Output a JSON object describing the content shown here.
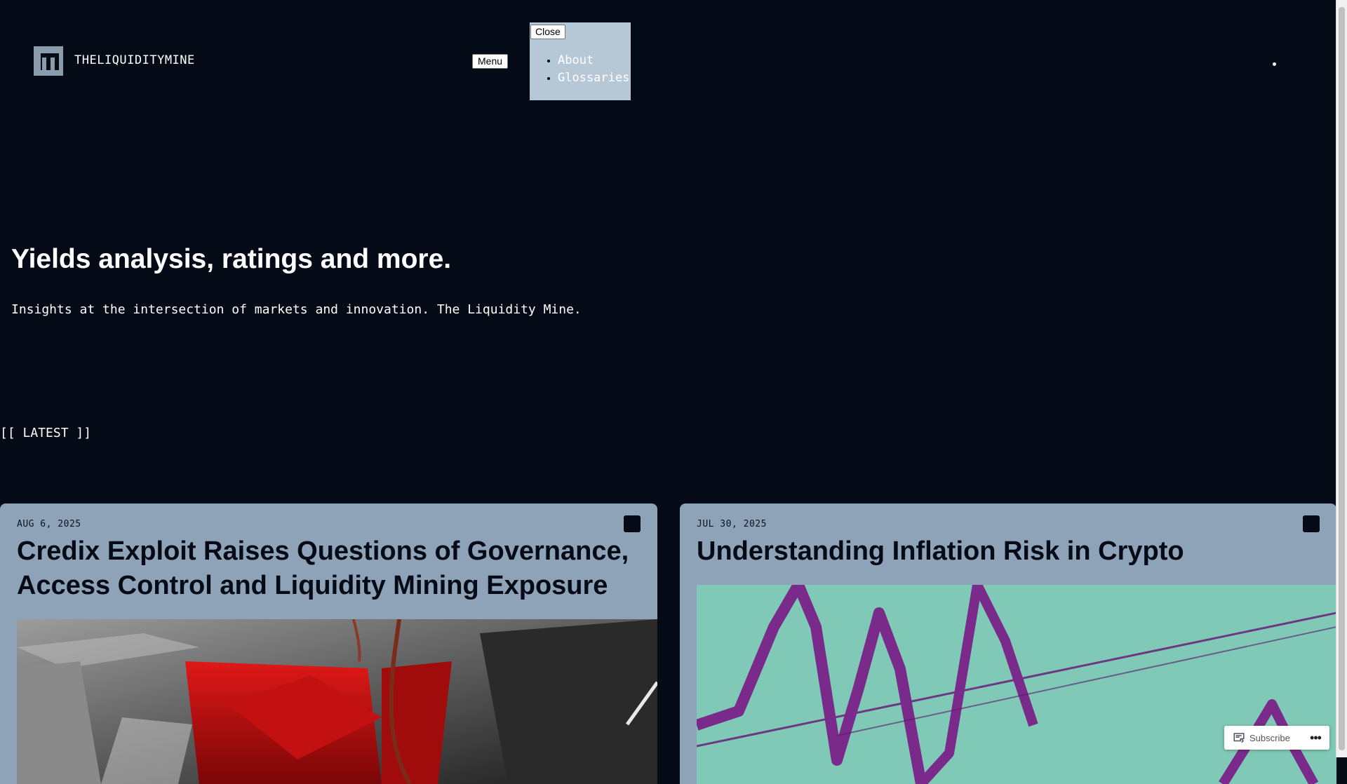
{
  "header": {
    "site_title": "THELIQUIDITYMINE",
    "menu_label": "Menu",
    "close_label": "Close",
    "nav_items": [
      {
        "label": "About"
      },
      {
        "label": "Glossaries"
      }
    ],
    "social_icon": "x-twitter-icon"
  },
  "hero": {
    "title": "Yields analysis, ratings and more.",
    "subtitle": "Insights at the intersection of markets and innovation. The Liquidity Mine."
  },
  "latest": {
    "label": "[[ LATEST ]]"
  },
  "posts": [
    {
      "date": "AUG 6, 2025",
      "title": "Credix Exploit Raises Questions of Governance, Access Control and Liquidity Mining Exposure",
      "image_icon": "fishhook-over-red-envelopes-image"
    },
    {
      "date": "JUL 30, 2025",
      "title": "Understanding Inflation Risk in Crypto",
      "image_icon": "purple-line-chart-on-teal-image"
    }
  ],
  "subscribe_bar": {
    "subscribe_label": "Subscribe",
    "more_label": "•••"
  },
  "colors": {
    "background": "#050b16",
    "card": "#8ea3b7",
    "nav_panel": "#b6c7d6"
  }
}
